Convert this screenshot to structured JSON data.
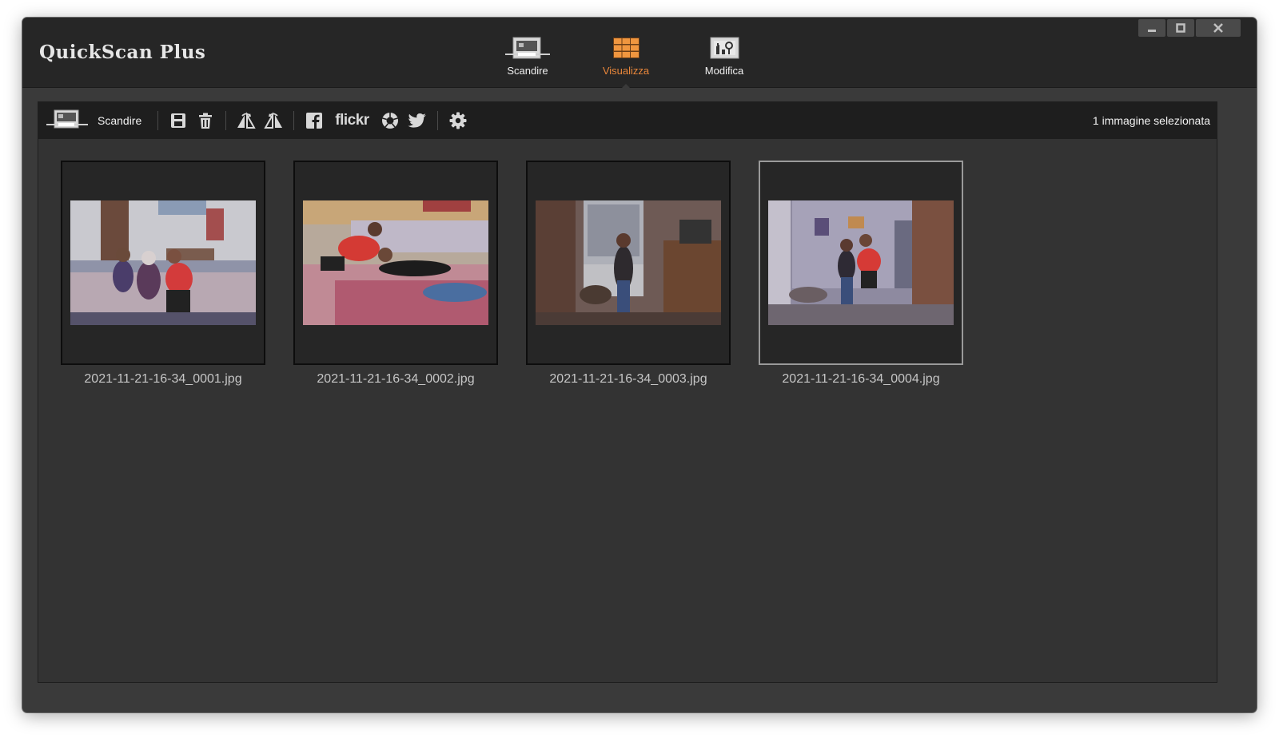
{
  "app": {
    "title": "QuickScan Plus"
  },
  "main_tabs": [
    {
      "label": "Scandire",
      "icon": "scanner-icon",
      "active": false
    },
    {
      "label": "Visualizza",
      "icon": "grid-view-icon",
      "active": true
    },
    {
      "label": "Modifica",
      "icon": "edit-tools-icon",
      "active": false
    }
  ],
  "toolbar": {
    "scan_label": "Scandire",
    "flickr_label": "flickr",
    "buttons": [
      "save-icon",
      "trash-icon",
      "flip-horizontal-icon",
      "flip-vertical-icon",
      "facebook-icon",
      "flickr-icon",
      "picasa-icon",
      "twitter-icon",
      "settings-icon"
    ]
  },
  "status": {
    "selection": "1 immagine selezionata"
  },
  "thumbnails": [
    {
      "filename": "2021-11-21-16-34_0001.jpg",
      "selected": false
    },
    {
      "filename": "2021-11-21-16-34_0002.jpg",
      "selected": false
    },
    {
      "filename": "2021-11-21-16-34_0003.jpg",
      "selected": false
    },
    {
      "filename": "2021-11-21-16-34_0004.jpg",
      "selected": true
    }
  ],
  "colors": {
    "accent": "#e8863a",
    "titlebar": "#262626",
    "toolbar": "#1e1e1e",
    "canvas": "#333333",
    "selection_border": "#9a9a9a"
  }
}
